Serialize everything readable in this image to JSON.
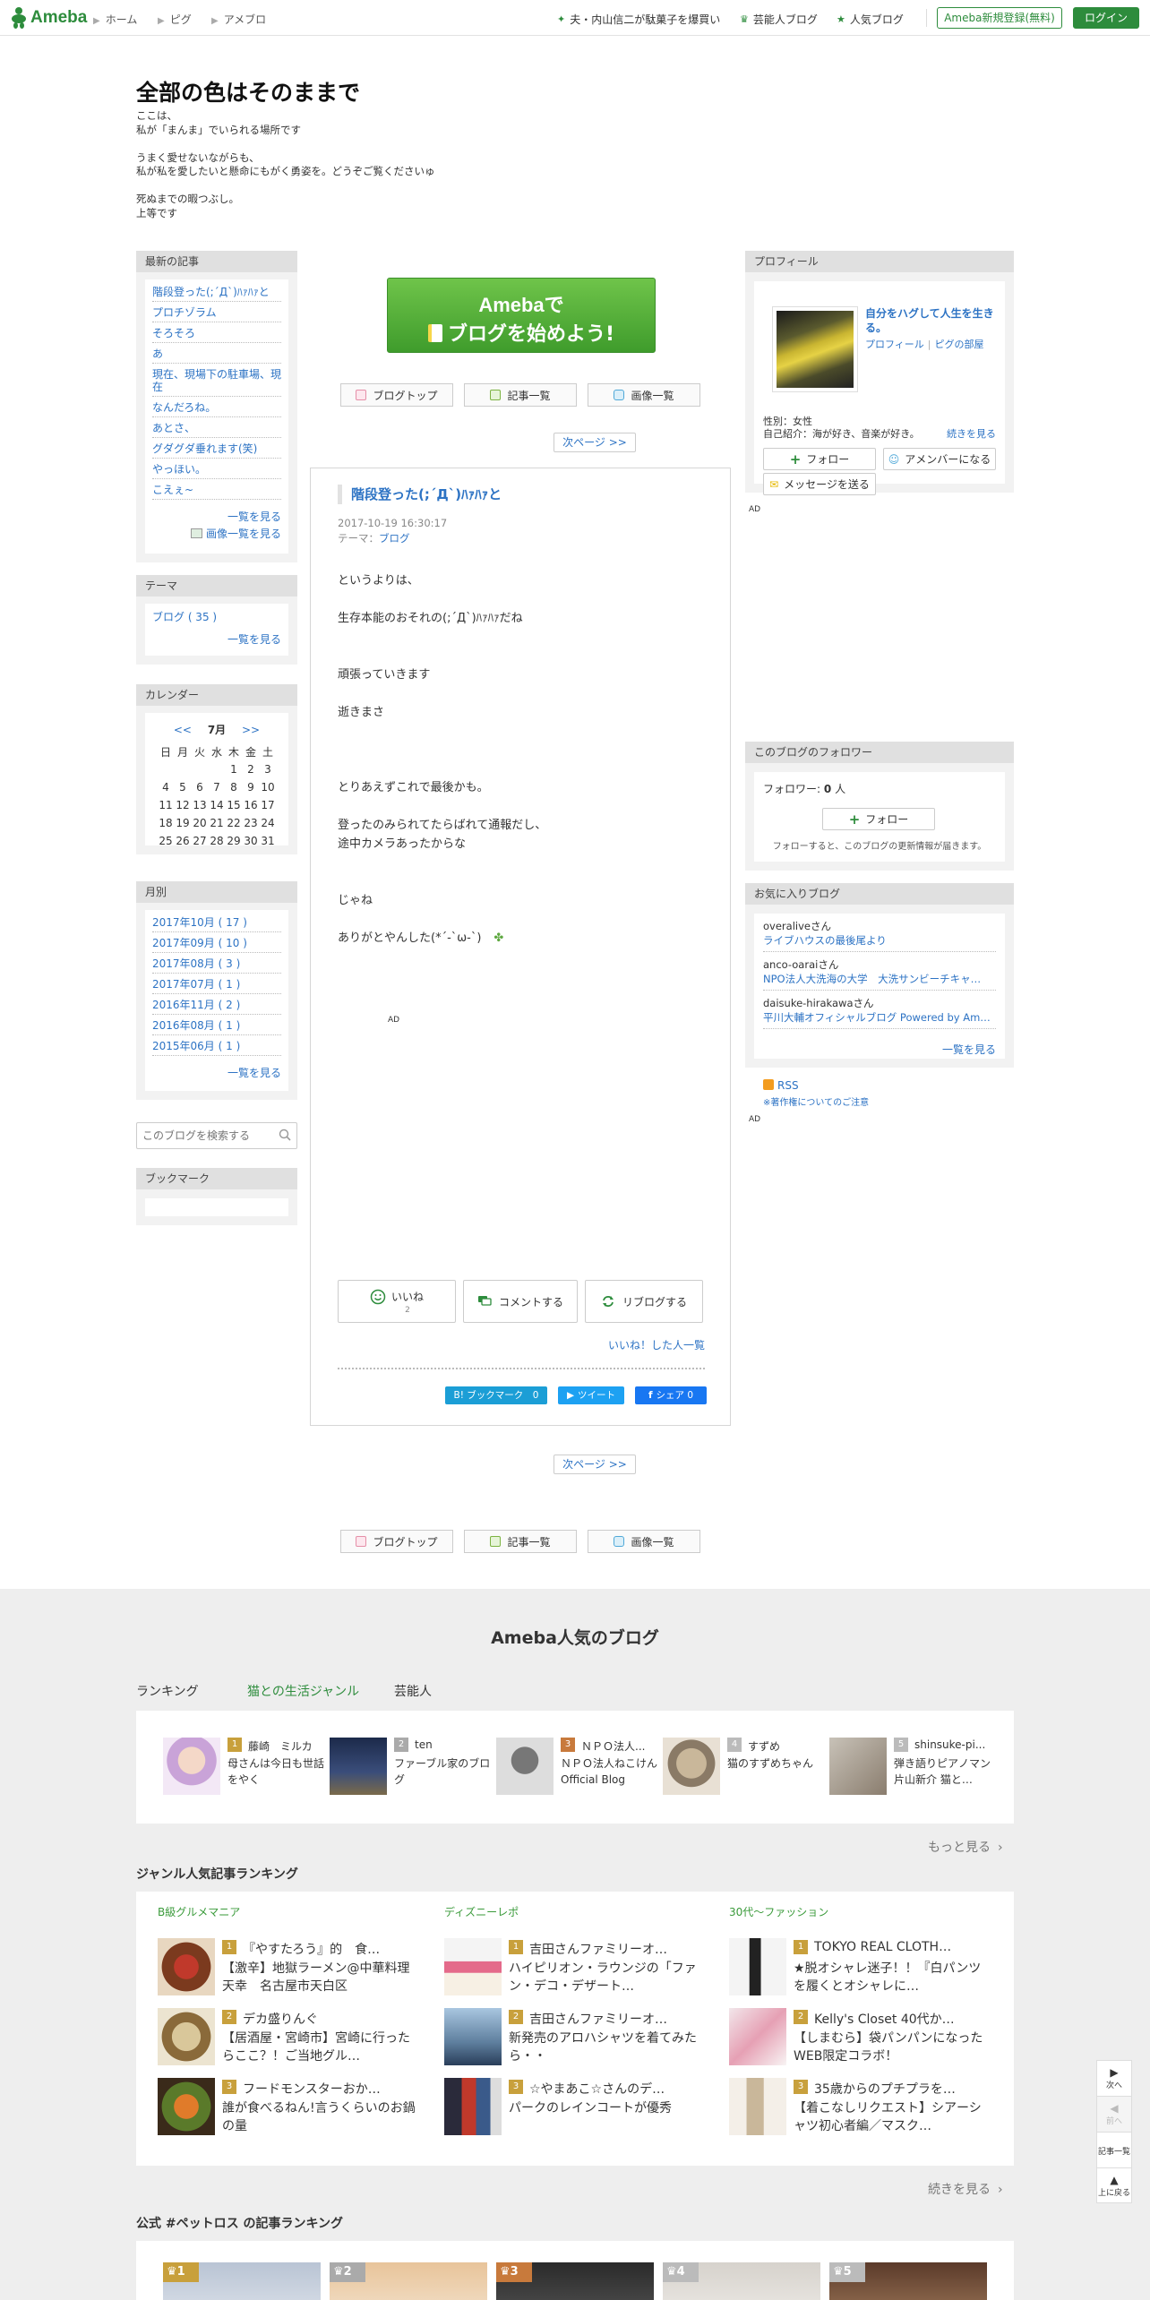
{
  "global_header": {
    "logo_text": "Ameba",
    "nav": [
      "ホーム",
      "ピグ",
      "アメブロ"
    ],
    "right_links": [
      "夫・内山信二が駄菓子を爆買い",
      "芸能人ブログ",
      "人気ブログ"
    ],
    "register_label": "Ameba新規登録(無料)",
    "login_label": "ログイン",
    "accent_color": "#2d8c3c"
  },
  "blog": {
    "title": "全部の色はそのままで",
    "description": "ここは、\n私が「まんま」でいられる場所です\n\nうまく愛せないながらも、\n私が私を愛したいと懸命にもがく勇姿を。どうぞご覧くださいゅ\n\n死ぬまでの暇つぶし。\n上等です"
  },
  "sidebar_left": {
    "recent": {
      "heading": "最新の記事",
      "items": [
        "階段登った(;´Д`)ﾊｧﾊｧと",
        "プロチゾラム",
        "そろそろ",
        "あ",
        "現在、現場下の駐車場、現在",
        "なんだろね。",
        "あとさ、",
        "グダグダ垂れます(笑)",
        "やっほい。",
        "こえぇ~"
      ],
      "more": "一覧を見る",
      "image_more": "画像一覧を見る"
    },
    "theme": {
      "heading": "テーマ",
      "items": [
        "ブログ ( 35 )"
      ],
      "more": "一覧を見る"
    },
    "calendar": {
      "heading": "カレンダー",
      "prev": "<<",
      "month": "7月",
      "next": ">>",
      "weekdays": [
        "日",
        "月",
        "火",
        "水",
        "木",
        "金",
        "土"
      ],
      "rows": [
        [
          "",
          "",
          "",
          "",
          "1",
          "2",
          "3"
        ],
        [
          "4",
          "5",
          "6",
          "7",
          "8",
          "9",
          "10"
        ],
        [
          "11",
          "12",
          "13",
          "14",
          "15",
          "16",
          "17"
        ],
        [
          "18",
          "19",
          "20",
          "21",
          "22",
          "23",
          "24"
        ],
        [
          "25",
          "26",
          "27",
          "28",
          "29",
          "30",
          "31"
        ]
      ]
    },
    "monthly": {
      "heading": "月別",
      "items": [
        "2017年10月 ( 17 )",
        "2017年09月 ( 10 )",
        "2017年08月 ( 3 )",
        "2017年07月 ( 1 )",
        "2016年11月 ( 2 )",
        "2016年08月 ( 1 )",
        "2015年06月 ( 1 )"
      ],
      "more": "一覧を見る"
    },
    "search_placeholder": "このブログを検索する",
    "bookmark": {
      "heading": "ブックマーク"
    }
  },
  "center": {
    "banner_line1": "Amebaで",
    "banner_line2": "ブログを始めよう!",
    "tabs": [
      "ブログトップ",
      "記事一覧",
      "画像一覧"
    ],
    "next_page": "次ページ >>",
    "article": {
      "title": "階段登った(;´Д`)ﾊｧﾊｧと",
      "date": "2017-10-19 16:30:17",
      "theme_label": "テーマ：",
      "theme_value": "ブログ",
      "paragraphs": [
        "というよりは、",
        "生存本能のおそれの(;´Д`)ﾊｧﾊｧだね",
        "頑張っていきます",
        "逝きまさ",
        "とりあえずこれで最後かも。",
        "登ったのみられてたらばれて通報だし、",
        "途中カメラあったからな",
        "じゃね",
        "ありがとやんした(*´-`ω-`)"
      ],
      "ad_label": "AD",
      "like_label": "いいね",
      "like_count": "2",
      "comment_label": "コメントする",
      "reblog_label": "リブログする",
      "likers_link": "いいね！した人一覧",
      "bookmark_share": "B! ブックマーク　0",
      "tweet_share": "ツイート",
      "fb_share": "シェア 0"
    }
  },
  "sidebar_right": {
    "profile": {
      "heading": "プロフィール",
      "tagline": "自分をハグして人生を生きる。",
      "links": [
        "プロフィール",
        "ピグの部屋"
      ],
      "gender": "性別：女性",
      "intro": "自己紹介：海が好き、音楽が好き。",
      "more": "続きを見る",
      "follow": "フォロー",
      "member": "アメンバーになる",
      "message": "メッセージを送る"
    },
    "ad_label": "AD",
    "followers": {
      "heading": "このブログのフォロワー",
      "count_label": "フォロワー:",
      "count": "0",
      "unit": "人",
      "follow": "フォロー",
      "note": "フォローすると、このブログの更新情報が届きます。"
    },
    "favorites": {
      "heading": "お気に入りブログ",
      "items": [
        {
          "user": "overaliveさん",
          "blog": "ライブハウスの最後尾より"
        },
        {
          "user": "anco-oaraiさん",
          "blog": "NPO法人大洗海の大学　大洗サンビーチキャ…"
        },
        {
          "user": "daisuke-hirakawaさん",
          "blog": "平川大輔オフィシャルブログ Powered by Am…"
        }
      ],
      "more": "一覧を見る"
    },
    "rss": "RSS",
    "copyright_note": "※著作権についてのご注意"
  },
  "footer": {
    "title": "Ameba人気のブログ",
    "tabs": [
      "ランキング",
      "猫との生活ジャンル",
      "芸能人"
    ],
    "ranking": [
      {
        "rank": "1",
        "name": "藤崎　ミルカ",
        "desc": "母さんは今日も世話をやく",
        "color": "#c8a03c"
      },
      {
        "rank": "2",
        "name": "ten",
        "desc": "ファーブル家のブログ",
        "color": "#aaaaaa"
      },
      {
        "rank": "3",
        "name": "ＮＰＯ法人...",
        "desc": "ＮＰＯ法人ねこけん Official Blog",
        "color": "#c87a3c"
      },
      {
        "rank": "4",
        "name": "すずめ",
        "desc": "猫のすずめちゃん",
        "color": "#bbbbbb"
      },
      {
        "rank": "5",
        "name": "shinsuke-pi...",
        "desc": "弾き語りピアノマン片山新介 猫と…",
        "color": "#bbbbbb"
      }
    ],
    "more": "もっと見る",
    "genre_title": "ジャンル人気記事ランキング",
    "genres": [
      {
        "name": "B級グルメマニア",
        "items": [
          {
            "rank": "1",
            "name": "『やすたろう』的　食…",
            "desc": "【激辛】地獄ラーメン@中華料理　天幸　名古屋市天白区"
          },
          {
            "rank": "2",
            "name": "デカ盛りんぐ",
            "desc": "【居酒屋・宮崎市】宮崎に行ったらここ？！ご当地グル…"
          },
          {
            "rank": "3",
            "name": "フードモンスターおか…",
            "desc": "誰が食べるねん!言うくらいのお鍋の量"
          }
        ]
      },
      {
        "name": "ディズニーレポ",
        "items": [
          {
            "rank": "1",
            "name": "吉田さんファミリーオ…",
            "desc": "ハイピリオン・ラウンジの「ファン・デコ・デザート…"
          },
          {
            "rank": "2",
            "name": "吉田さんファミリーオ…",
            "desc": "新発売のアロハシャツを着てみたら・・"
          },
          {
            "rank": "3",
            "name": "☆やまあこ☆さんのデ…",
            "desc": "パークのレインコートが優秀"
          }
        ]
      },
      {
        "name": "30代〜ファッション",
        "items": [
          {
            "rank": "1",
            "name": "TOKYO REAL CLOTH…",
            "desc": "★脱オシャレ迷子！！『白パンツを履くとオシャレに…"
          },
          {
            "rank": "2",
            "name": "Kelly's Closet 40代か…",
            "desc": "【しまむら】袋パンパンになったWEB限定コラボ！"
          },
          {
            "rank": "3",
            "name": "35歳からのプチプラを…",
            "desc": "【着こなしリクエスト】シアーシャツ初心者編／マスク…"
          }
        ]
      }
    ],
    "genre_more": "続きを見る",
    "official_title": "公式 #ペットロス の記事ランキング",
    "official_ranks": [
      "1",
      "2",
      "3",
      "4",
      "5"
    ]
  },
  "float_nav": {
    "next": "次へ",
    "prev": "前へ",
    "list": "記事一覧",
    "top": "上に戻る"
  }
}
